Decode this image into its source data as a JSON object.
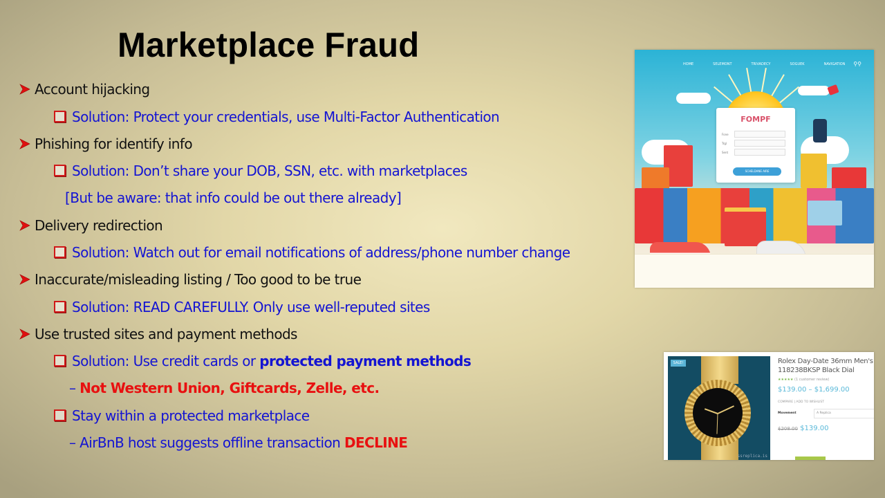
{
  "slide": {
    "title": "Marketplace Fraud",
    "bullets": [
      {
        "text": "Account hijacking"
      },
      {
        "text": "Phishing for identify info"
      },
      {
        "text": "Delivery redirection"
      },
      {
        "text": "Inaccurate/misleading listing / Too good to be true"
      },
      {
        "text": "Use trusted sites and payment methods"
      }
    ],
    "solutions": {
      "hijacking": "Solution: Protect your credentials, use Multi-Factor Authentication",
      "phishing": "Solution: Don’t share your DOB, SSN, etc. with marketplaces",
      "phishing_note": "[But be aware:  that info could be out there already]",
      "delivery": "Solution: Watch out for email notifications of address/phone number change",
      "listing": "Solution: READ CAREFULLY. Only use well-reputed sites",
      "payment_prefix": "Solution: Use credit cards or ",
      "payment_bold": "protected payment methods",
      "not_methods_dash": "– ",
      "not_methods": "Not Western Union,  Giftcards,  Zelle, etc.",
      "marketplace": "Stay within a protected marketplace",
      "airbnb_prefix": "– AirBnB host suggests offline transaction ",
      "airbnb_action": "DECLINE"
    }
  },
  "illustration": {
    "nav_items": [
      "HOME",
      "SELEMONT",
      "TRIVADECY",
      "SOGUEK",
      "NAVIGATION"
    ],
    "form_title": "FOMPF",
    "form_labels": [
      "Fone",
      "Trgl",
      "Sent"
    ],
    "form_button": "SCHELDANE AIRE"
  },
  "listing": {
    "sale_badge": "SALE!",
    "product_name": "Rolex Day-Date 36mm Men's 118238BKSP Black Dial",
    "stars": "★★★★★",
    "review_count": "(1 customer review)",
    "price_range": "$139.00 – $1,699.00",
    "links": "COMPARE   |   ADD TO WISHLIST",
    "movement_label": "Movement",
    "movement_value": "A Replica",
    "old_price": "$208.00",
    "price": "$139.00",
    "watermark": "ssreplica.is"
  },
  "colors": {
    "accent_blue": "#1414d2",
    "accent_red": "#e81010",
    "bullet_red": "#d01818"
  }
}
